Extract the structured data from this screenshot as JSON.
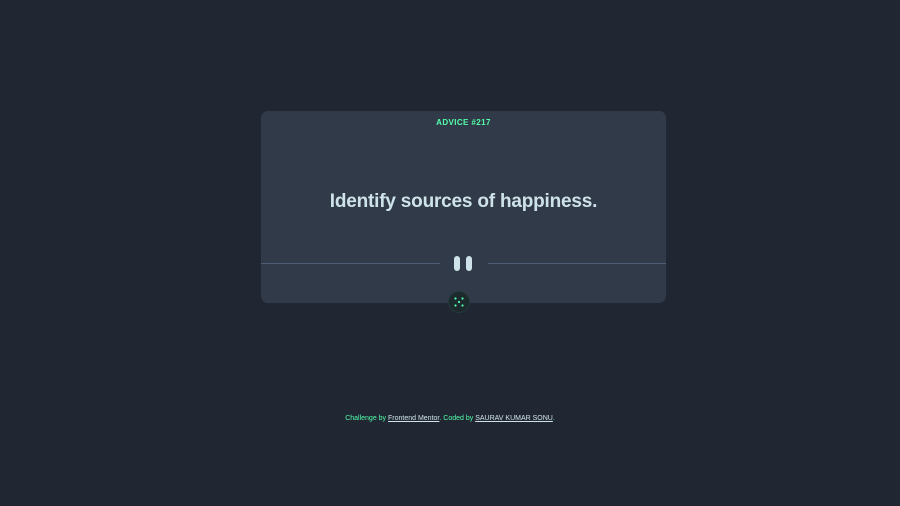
{
  "card": {
    "advice_label": "ADVICE #217",
    "advice_text": "Identify sources of happiness."
  },
  "icons": {
    "divider": "pause-icon",
    "generate": "dice-icon"
  },
  "footer": {
    "prefix": "Challenge by ",
    "link1": "Frontend Mentor",
    "middle": ". Coded by ",
    "link2": "SAURAV KUMAR SONU",
    "suffix": "."
  },
  "colors": {
    "background": "#202733",
    "card": "#313a48",
    "accent": "#53ffaa",
    "text": "#cee3e9",
    "divider": "#4f5d74"
  }
}
